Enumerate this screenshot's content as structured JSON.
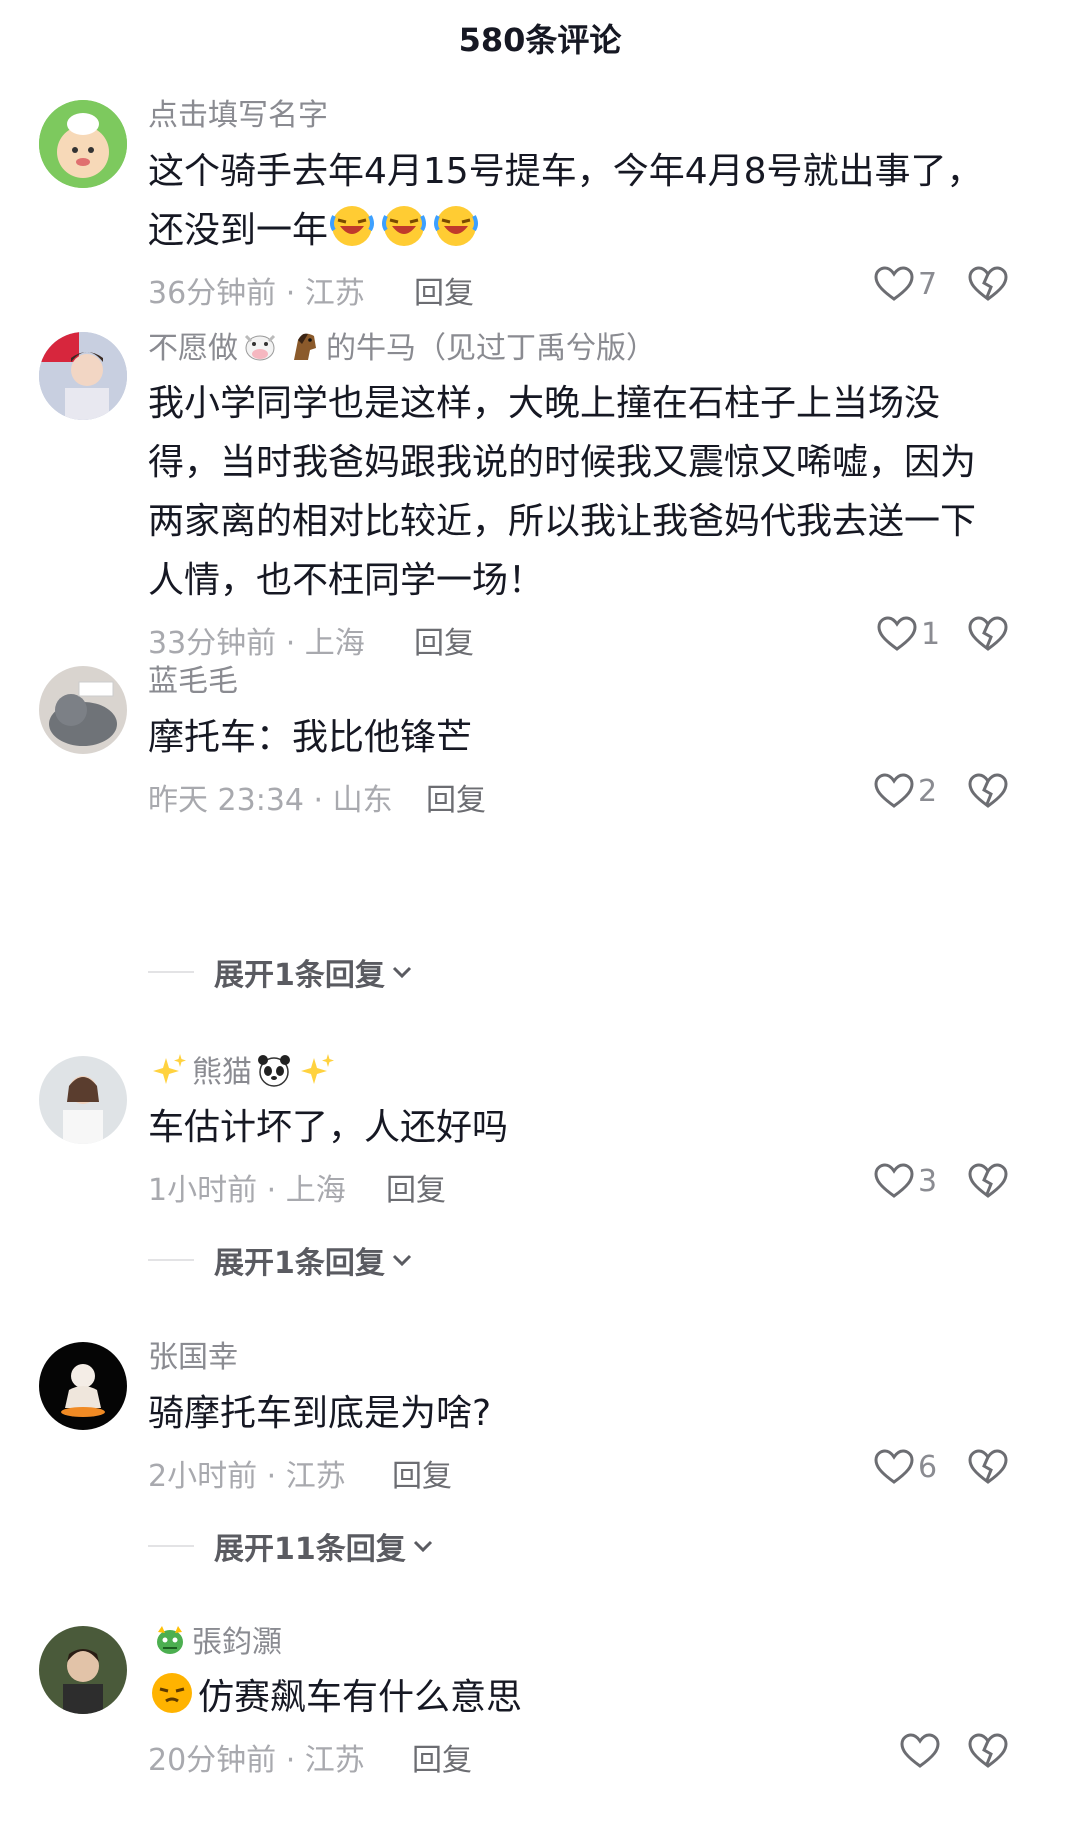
{
  "header": {
    "title": "580条评论"
  },
  "comments": [
    {
      "username": "点击填写名字",
      "text": "这个骑手去年4月15号提车，今年4月8号就出事了，还没到一年",
      "time": "36分钟前 · 江苏",
      "reply_label": "回复",
      "likes": "7",
      "trailing_emoji": "laugh-cry-emoji ×3"
    },
    {
      "username_prefix": "不愿做",
      "username_suffix": "的牛马（见过丁禹兮版）",
      "text": "我小学同学也是这样，大晚上撞在石柱子上当场没得，当时我爸妈跟我说的时候我又震惊又唏嘘，因为两家离的相对比较近，所以我让我爸妈代我去送一下人情，也不枉同学一场！",
      "time": "33分钟前 · 上海",
      "reply_label": "回复",
      "likes": "1"
    },
    {
      "username": "蓝毛毛",
      "text": "摩托车：我比他锋芒",
      "time": "昨天 23:34 · 山东",
      "reply_label": "回复",
      "likes": "2",
      "expand_label": "展开1条回复"
    },
    {
      "username": "熊猫",
      "text": "车估计坏了，人还好吗",
      "time": "1小时前 · 上海",
      "reply_label": "回复",
      "likes": "3",
      "expand_label": "展开1条回复"
    },
    {
      "username": "张国幸",
      "text": "骑摩托车到底是为啥?",
      "time": "2小时前 · 江苏",
      "reply_label": "回复",
      "likes": "6",
      "expand_label": "展开11条回复"
    },
    {
      "username": "張鈞灝",
      "text": "仿赛飙车有什么意思",
      "time": "20分钟前 · 江苏",
      "reply_label": "回复",
      "likes": ""
    }
  ],
  "icons": {
    "like": "heart-outline-icon",
    "dislike": "broken-heart-icon",
    "expand": "chevron-down-icon"
  },
  "colors": {
    "text": "#161823",
    "username": "#8a8b91",
    "meta": "#a8a9ae"
  }
}
